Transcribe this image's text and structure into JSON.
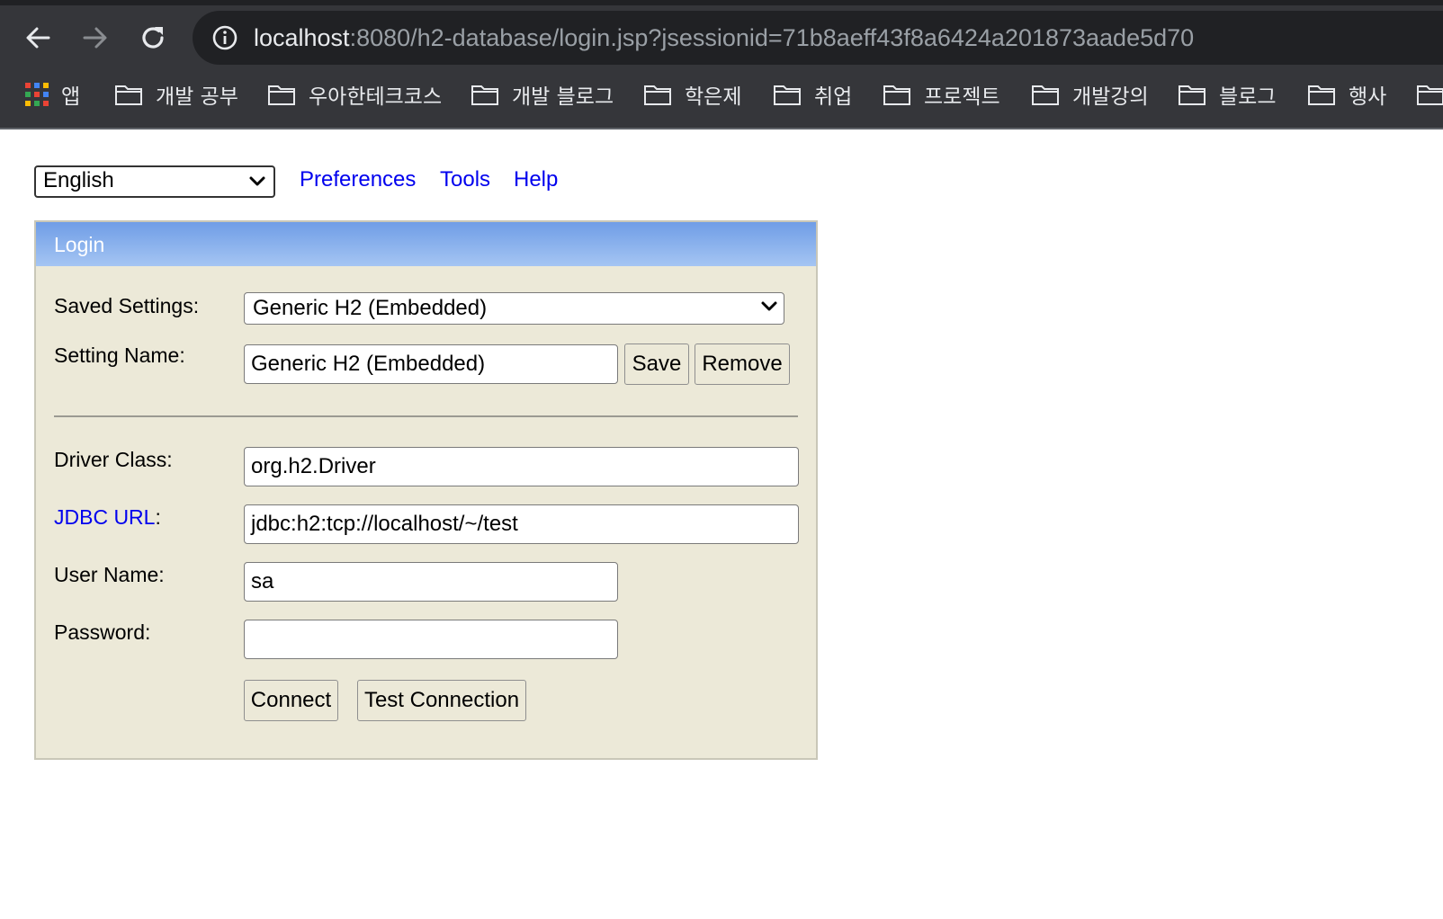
{
  "browser": {
    "url_host": "localhost",
    "url_rest": ":8080/h2-database/login.jsp?jsessionid=71b8aeff43f8a6424a201873aade5d70",
    "bookmarks": [
      {
        "label": "앱",
        "icon": "apps-grid-icon"
      },
      {
        "label": "개발 공부",
        "icon": "folder-icon"
      },
      {
        "label": "우아한테크코스",
        "icon": "folder-icon"
      },
      {
        "label": "개발 블로그",
        "icon": "folder-icon"
      },
      {
        "label": "학은제",
        "icon": "folder-icon"
      },
      {
        "label": "취업",
        "icon": "folder-icon"
      },
      {
        "label": "프로젝트",
        "icon": "folder-icon"
      },
      {
        "label": "개발강의",
        "icon": "folder-icon"
      },
      {
        "label": "블로그",
        "icon": "folder-icon"
      },
      {
        "label": "행사",
        "icon": "folder-icon"
      }
    ],
    "colors": {
      "chrome": "#35363a",
      "omnibox": "#202124"
    }
  },
  "toolbar": {
    "language": "English",
    "links": [
      "Preferences",
      "Tools",
      "Help"
    ]
  },
  "login": {
    "title": "Login",
    "saved_settings_label": "Saved Settings:",
    "saved_settings_value": "Generic H2 (Embedded)",
    "setting_name_label": "Setting Name:",
    "setting_name_value": "Generic H2 (Embedded)",
    "save_label": "Save",
    "remove_label": "Remove",
    "driver_class_label": "Driver Class:",
    "driver_class_value": "org.h2.Driver",
    "jdbc_url_label": "JDBC URL",
    "jdbc_url_colon": ":",
    "jdbc_url_value": "jdbc:h2:tcp://localhost/~/test",
    "user_name_label": "User Name:",
    "user_name_value": "sa",
    "password_label": "Password:",
    "password_value": "",
    "connect_label": "Connect",
    "test_connection_label": "Test Connection",
    "colors": {
      "panel": "#ece9d8",
      "header_top": "#6f9de6",
      "header_bottom": "#a5c5f3",
      "link": "#0000ee"
    }
  }
}
